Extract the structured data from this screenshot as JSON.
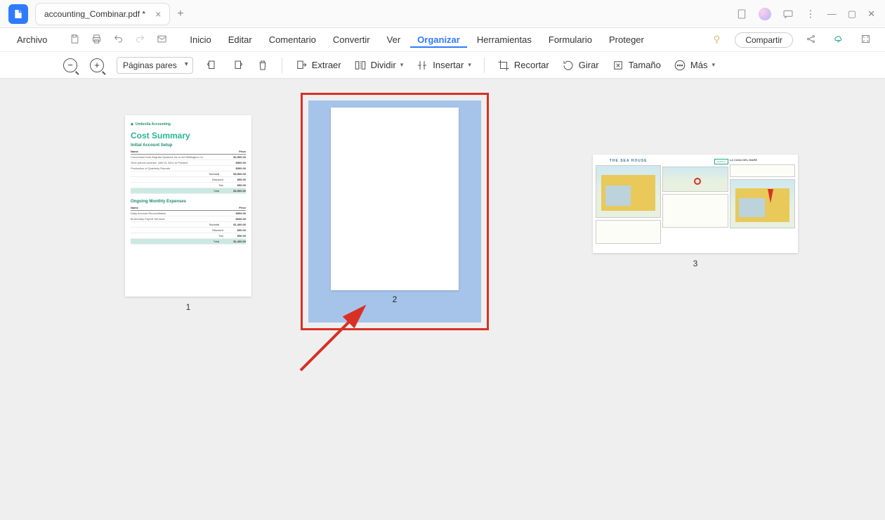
{
  "titlebar": {
    "tab_title": "accounting_Combinar.pdf *"
  },
  "menubar": {
    "file": "Archivo",
    "items": [
      "Inicio",
      "Editar",
      "Comentario",
      "Convertir",
      "Ver",
      "Organizar",
      "Herramientas",
      "Formulario",
      "Proteger"
    ],
    "active_index": 5,
    "share": "Compartir"
  },
  "toolbar": {
    "select_label": "Páginas pares",
    "extract": "Extraer",
    "split": "Dividir",
    "insert": "Insertar",
    "crop": "Recortar",
    "rotate": "Girar",
    "size": "Tamaño",
    "more": "Más"
  },
  "pages": {
    "p1_num": "1",
    "p2_num": "2",
    "p3_num": "3",
    "p1": {
      "brand": "Umbrella Accounting",
      "title": "Cost Summary",
      "section1": "Initial Account Setup",
      "hdr_name": "Name",
      "hdr_price": "Price",
      "r1a": "Conversion from Angular Systems Inc to A4 Wellington Co",
      "r1b": "$2,500.00",
      "r2a": "Time period covered: JAN 01 2021 to Present",
      "r2b": "$500.00",
      "r3a": "Production of Quarterly Reports",
      "r3b": "$500.00",
      "sub": "Subtotal",
      "subv": "$3,500.00",
      "disc": "Discount",
      "discv": "$50.00",
      "tax": "Tax",
      "taxv": "$50.00",
      "tot": "Total",
      "totv": "$3,500.00",
      "section2": "Ongoing Monthly Expenses",
      "r4a": "Daily Account Reconciliation",
      "r4b": "$500.00",
      "r5a": "Bi-Monthly Payroll Services",
      "r5b": "$600.00",
      "sub2v": "$1,400.00",
      "tot2v": "$1,400.00"
    },
    "p3": {
      "title": "THE SEA HOUSE",
      "header2": "LA CASA DEL MARE",
      "badge": "Featured"
    }
  }
}
